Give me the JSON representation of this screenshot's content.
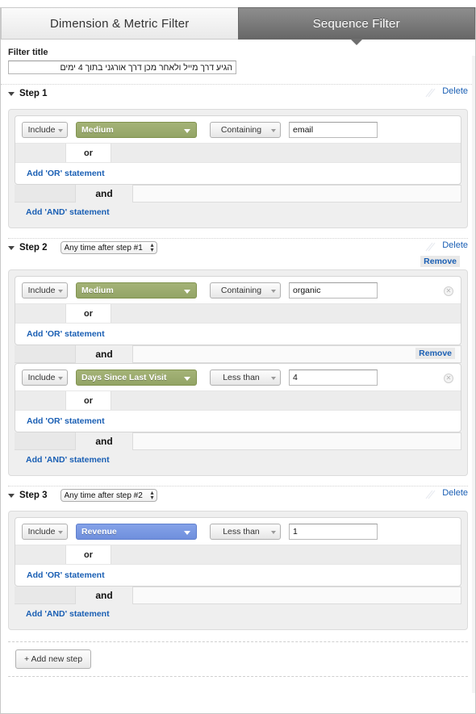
{
  "tabs": [
    {
      "label": "Dimension & Metric Filter",
      "active": false
    },
    {
      "label": "Sequence Filter",
      "active": true
    }
  ],
  "filter_title": {
    "label": "Filter title",
    "value": "הגיע דרך מייל ולאחר מכן דרך אורגני בתוך 4 ימים",
    "placeholder": ""
  },
  "labels": {
    "delete": "Delete",
    "remove": "Remove",
    "add_or": "Add 'OR' statement",
    "add_and": "Add 'AND' statement",
    "or": "or",
    "and": "and",
    "add_new_step": "+ Add new step"
  },
  "colors": {
    "dimension_green": "#93a466",
    "metric_blue": "#6f8fdd",
    "link_blue": "#1a5fb4",
    "active_tab_grey": "#7d7d7d"
  },
  "steps": [
    {
      "title": "Step 1",
      "timing": null,
      "groups": [
        {
          "show_remove": false,
          "conditions": [
            {
              "include": "Include",
              "dimension": "Medium",
              "dimension_type": "green",
              "operator": "Containing",
              "value": "email",
              "has_clear": false
            }
          ]
        }
      ]
    },
    {
      "title": "Step 2",
      "timing": "Any time after step #1",
      "groups": [
        {
          "show_remove": true,
          "conditions": [
            {
              "include": "Include",
              "dimension": "Medium",
              "dimension_type": "green",
              "operator": "Containing",
              "value": "organic",
              "has_clear": true
            }
          ]
        },
        {
          "show_remove": true,
          "conditions": [
            {
              "include": "Include",
              "dimension": "Days Since Last Visit",
              "dimension_type": "green",
              "operator": "Less than",
              "value": "4",
              "has_clear": true
            }
          ]
        }
      ]
    },
    {
      "title": "Step 3",
      "timing": "Any time after step #2",
      "groups": [
        {
          "show_remove": false,
          "conditions": [
            {
              "include": "Include",
              "dimension": "Revenue",
              "dimension_type": "blue",
              "operator": "Less than",
              "value": "1",
              "has_clear": false
            }
          ]
        }
      ]
    }
  ]
}
